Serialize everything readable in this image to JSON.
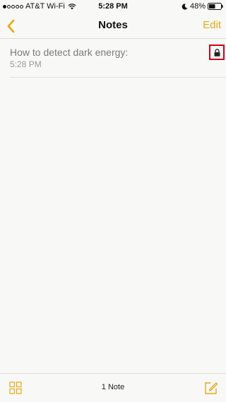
{
  "status_bar": {
    "carrier": "AT&T Wi-Fi",
    "time": "5:28 PM",
    "battery": "48%"
  },
  "nav": {
    "back_icon": "chevron-left-icon",
    "title": "Notes",
    "edit_label": "Edit"
  },
  "notes": [
    {
      "title": "How to detect dark energy:",
      "time": "5:28 PM",
      "locked": true
    }
  ],
  "toolbar": {
    "note_count": "1 Note",
    "gallery_icon": "grid-icon",
    "compose_icon": "compose-icon"
  },
  "colors": {
    "accent": "#e6a817",
    "highlight": "#d0021b",
    "background": "#f8f8f6"
  }
}
